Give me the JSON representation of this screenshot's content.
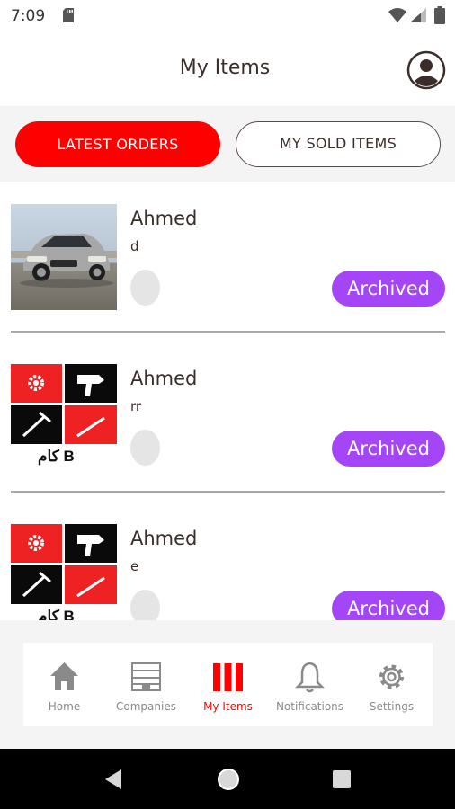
{
  "status_bar": {
    "time": "7:09",
    "icons": [
      "sd-card-icon",
      "wifi-icon",
      "signal-icon",
      "battery-icon"
    ]
  },
  "header": {
    "title": "My Items",
    "profile_icon": "account-circle-icon"
  },
  "tabs": [
    {
      "label": "LATEST ORDERS",
      "active": true
    },
    {
      "label": "MY SOLD ITEMS",
      "active": false
    }
  ],
  "items": [
    {
      "name": "Ahmed",
      "description": "d",
      "status": "Archived",
      "image": "car-photo"
    },
    {
      "name": "Ahmed",
      "description": "rr",
      "status": "Archived",
      "image": "tools-logo"
    },
    {
      "name": "Ahmed",
      "description": "e",
      "status": "Archived",
      "image": "tools-logo"
    }
  ],
  "logo_text": "كام B",
  "bottom_nav": [
    {
      "label": "Home",
      "icon": "home-icon",
      "active": false
    },
    {
      "label": "Companies",
      "icon": "building-icon",
      "active": false
    },
    {
      "label": "My Items",
      "icon": "items-icon",
      "active": true
    },
    {
      "label": "Notifications",
      "icon": "bell-icon",
      "active": false
    },
    {
      "label": "Settings",
      "icon": "gear-icon",
      "active": false
    }
  ],
  "colors": {
    "accent": "#ff0000",
    "badge": "#a445f7",
    "text": "#3b2e2a",
    "inactive_nav": "#8a8a8a"
  }
}
